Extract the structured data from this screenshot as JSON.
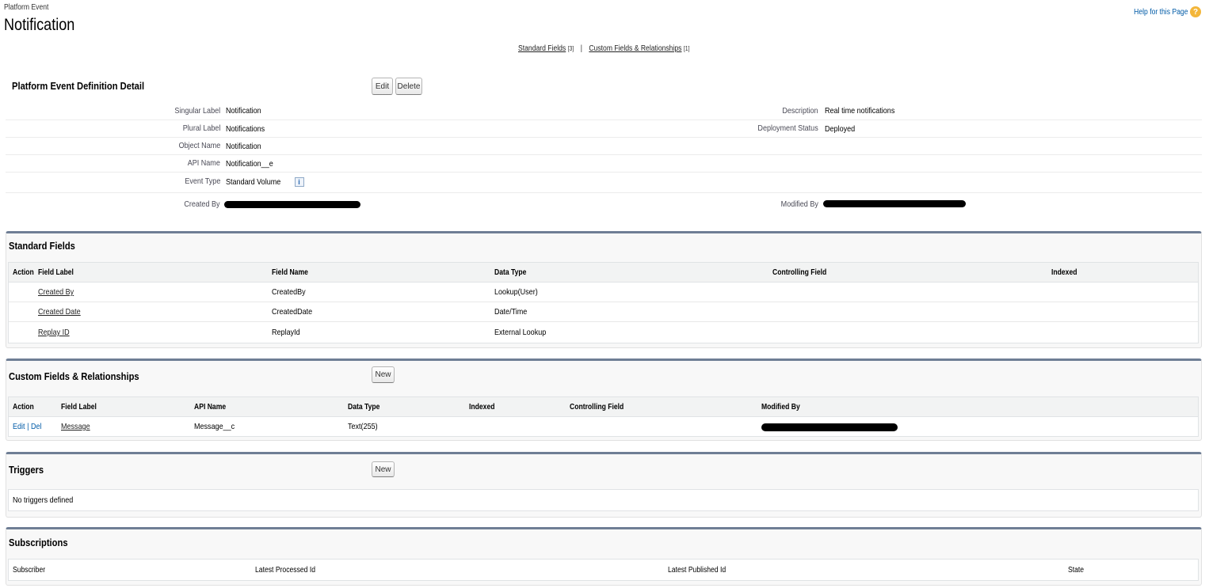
{
  "header": {
    "object_type": "Platform Event",
    "title": "Notification",
    "help_label": "Help for this Page",
    "help_icon": "help-icon"
  },
  "quicklinks": {
    "standard_label": "Standard Fields",
    "standard_count": "[3]",
    "separator": "|",
    "custom_label": "Custom Fields & Relationships",
    "custom_count": "[1]"
  },
  "detail": {
    "title": "Platform Event Definition Detail",
    "edit_button": "Edit",
    "delete_button": "Delete",
    "singular_label": {
      "label": "Singular Label",
      "value": "Notification"
    },
    "plural_label": {
      "label": "Plural Label",
      "value": "Notifications"
    },
    "object_name": {
      "label": "Object Name",
      "value": "Notification"
    },
    "api_name": {
      "label": "API Name",
      "value": "Notification__e"
    },
    "event_type": {
      "label": "Event Type",
      "value": "Standard Volume",
      "icon": "info-icon"
    },
    "created_by": {
      "label": "Created By"
    },
    "description": {
      "label": "Description",
      "value": "Real time notifications"
    },
    "deployment_status": {
      "label": "Deployment Status",
      "value": "Deployed"
    },
    "modified_by": {
      "label": "Modified By"
    }
  },
  "standard_fields": {
    "title": "Standard Fields",
    "headers": [
      "Action",
      "Field Label",
      "Field Name",
      "Data Type",
      "Controlling Field",
      "Indexed"
    ],
    "rows": [
      {
        "label": "Created By",
        "name": "CreatedBy",
        "type": "Lookup(User)"
      },
      {
        "label": "Created Date",
        "name": "CreatedDate",
        "type": "Date/Time"
      },
      {
        "label": "Replay ID",
        "name": "ReplayId",
        "type": "External Lookup"
      }
    ]
  },
  "custom_fields": {
    "title": "Custom Fields & Relationships",
    "new_button": "New",
    "headers": [
      "Action",
      "Field Label",
      "API Name",
      "Data Type",
      "Indexed",
      "Controlling Field",
      "Modified By"
    ],
    "rows": [
      {
        "edit": "Edit",
        "sep": "|",
        "del": "Del",
        "label": "Message",
        "api": "Message__c",
        "type": "Text(255)"
      }
    ]
  },
  "triggers": {
    "title": "Triggers",
    "new_button": "New",
    "empty_text": "No triggers defined"
  },
  "subscriptions": {
    "title": "Subscriptions",
    "headers": [
      "Subscriber",
      "Latest Processed Id",
      "Latest Published Id",
      "State"
    ]
  }
}
